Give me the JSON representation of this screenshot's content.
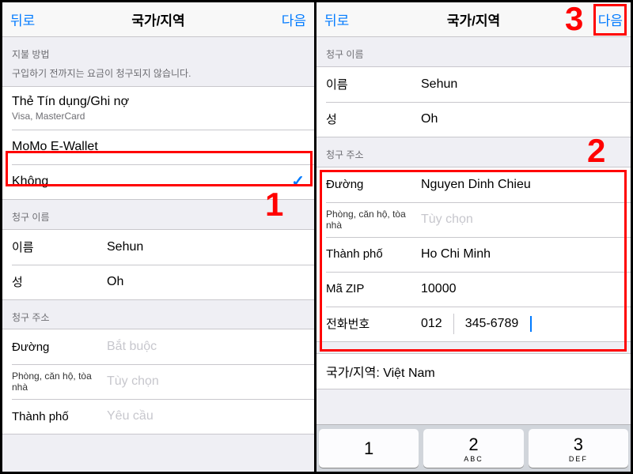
{
  "nav": {
    "back": "뒤로",
    "title": "국가/지역",
    "next": "다음"
  },
  "left": {
    "pay_header": "지불 방법",
    "pay_sub": "구입하기 전까지는 요금이 청구되지 않습니다.",
    "pay_items": [
      {
        "main": "Thẻ Tín dụng/Ghi nợ",
        "sub": "Visa, MasterCard"
      },
      {
        "main": "MoMo E-Wallet",
        "sub": ""
      },
      {
        "main": "Không",
        "sub": "",
        "selected": true
      }
    ],
    "name_header": "청구 이름",
    "first_lbl": "이름",
    "first_val": "Sehun",
    "last_lbl": "성",
    "last_val": "Oh",
    "addr_header": "청구 주소",
    "street_lbl": "Đường",
    "street_ph": "Bắt buộc",
    "apt_lbl": "Phòng, căn hộ, tòa nhà",
    "apt_ph": "Tùy chọn",
    "city_lbl": "Thành phố",
    "city_ph": "Yêu cầu"
  },
  "right": {
    "name_header": "청구 이름",
    "first_lbl": "이름",
    "first_val": "Sehun",
    "last_lbl": "성",
    "last_val": "Oh",
    "addr_header": "청구 주소",
    "street_lbl": "Đường",
    "street_val": "Nguyen Dinh Chieu",
    "apt_lbl": "Phòng, căn hộ, tòa nhà",
    "apt_ph": "Tùy chọn",
    "city_lbl": "Thành phố",
    "city_val": "Ho Chi Minh",
    "zip_lbl": "Mã ZIP",
    "zip_val": "10000",
    "phone_lbl": "전화번호",
    "phone_cc": "012",
    "phone_num": "345-6789",
    "country_row": "국가/지역: Việt Nam"
  },
  "keypad": {
    "k1": "1",
    "k1s": "",
    "k2": "2",
    "k2s": "ABC",
    "k3": "3",
    "k3s": "DEF"
  },
  "annot": {
    "n1": "1",
    "n2": "2",
    "n3": "3"
  }
}
